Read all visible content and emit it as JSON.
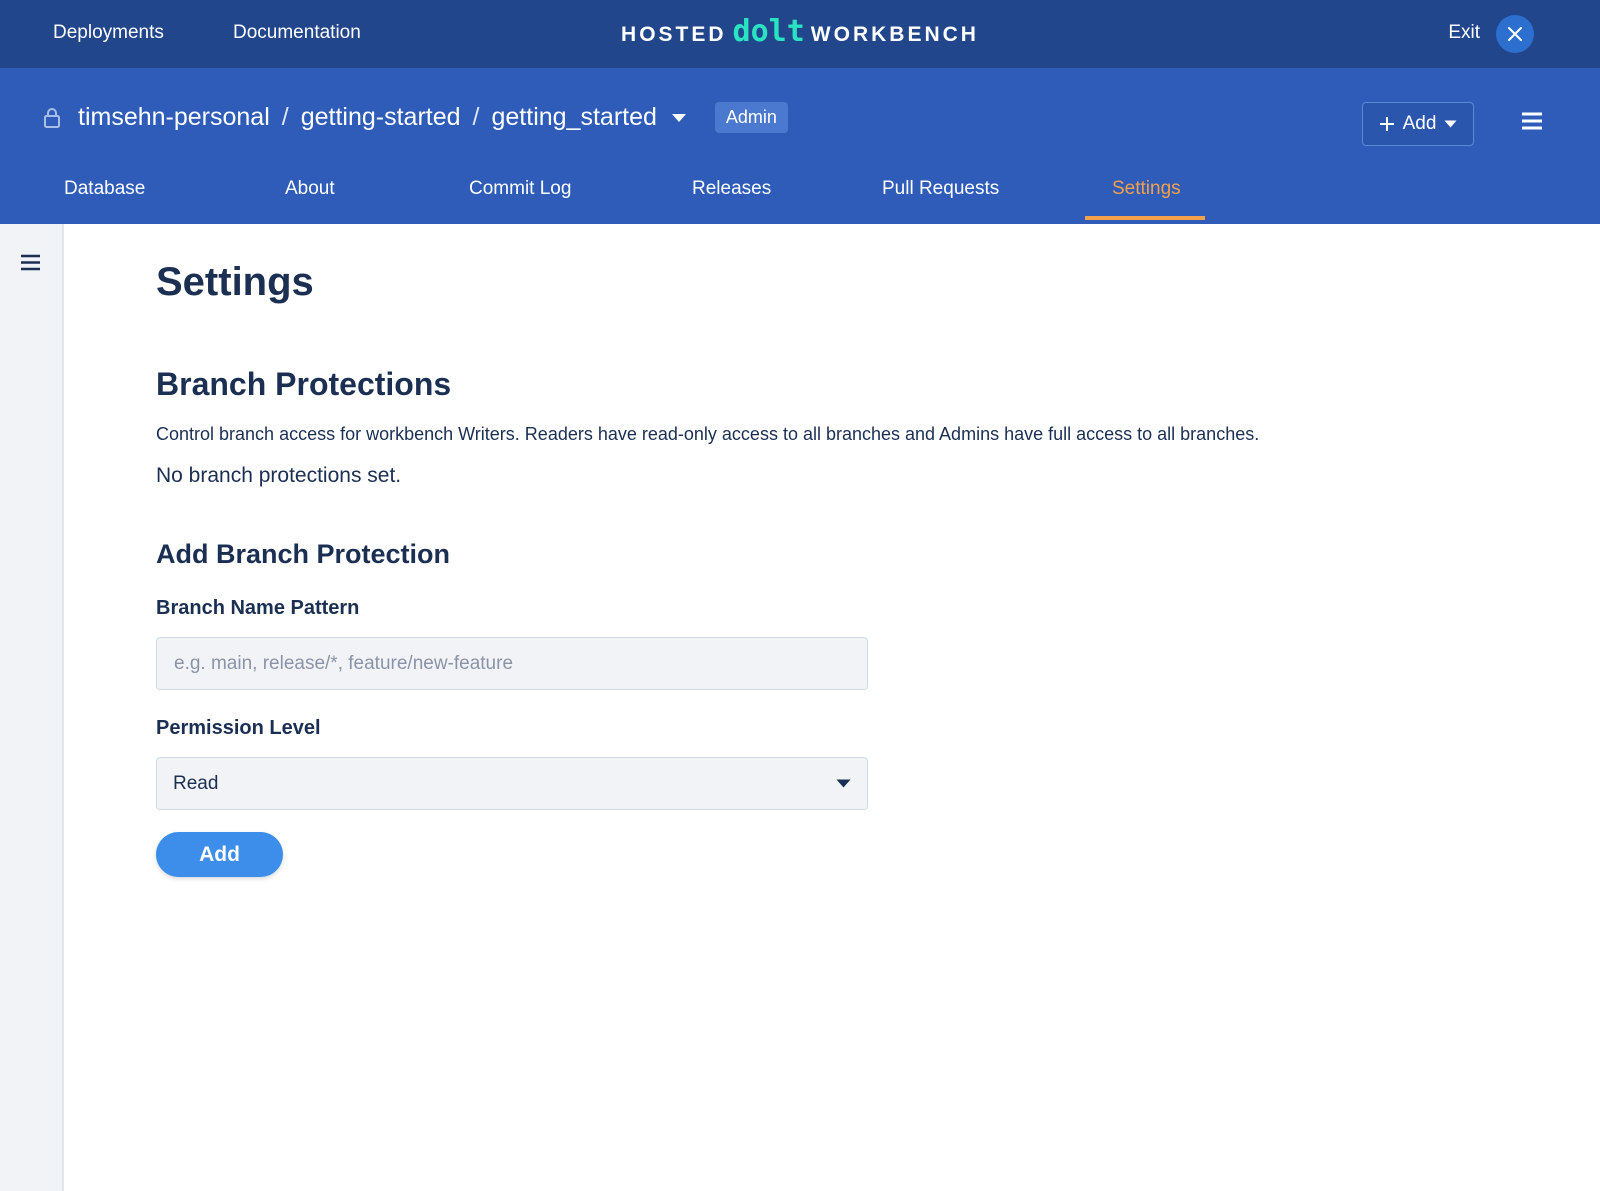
{
  "topnav": {
    "deployments_label": "Deployments",
    "documentation_label": "Documentation",
    "brand_left": "HOSTED",
    "brand_logo": "dolt",
    "brand_right": "WORKBENCH",
    "exit_label": "Exit"
  },
  "header": {
    "owner": "timsehn-personal",
    "deployment": "getting-started",
    "database": "getting_started",
    "separator": "/",
    "role_badge": "Admin",
    "add_label": "Add"
  },
  "tabs": [
    {
      "label": "Database"
    },
    {
      "label": "About"
    },
    {
      "label": "Commit Log"
    },
    {
      "label": "Releases"
    },
    {
      "label": "Pull Requests"
    },
    {
      "label": "Settings",
      "active": true
    }
  ],
  "main": {
    "title": "Settings",
    "branch_protections": {
      "title": "Branch Protections",
      "description": "Control branch access for workbench Writers. Readers have read-only access to all branches and Admins have full access to all branches.",
      "empty_message": "No branch protections set."
    },
    "add_form": {
      "title": "Add Branch Protection",
      "pattern_label": "Branch Name Pattern",
      "pattern_value": "",
      "pattern_placeholder": "e.g. main, release/*, feature/new-feature",
      "permission_label": "Permission Level",
      "permission_value": "Read",
      "submit_label": "Add"
    }
  },
  "colors": {
    "topbar": "#22468b",
    "header": "#2e5cb8",
    "active_tab": "#f5a04a",
    "brand_accent": "#29e3c1",
    "primary_button": "#3d8eea",
    "text": "#1b2f52"
  },
  "icons": [
    "lock-icon",
    "close-icon",
    "chevron-down-icon",
    "plus-icon",
    "menu-icon"
  ]
}
